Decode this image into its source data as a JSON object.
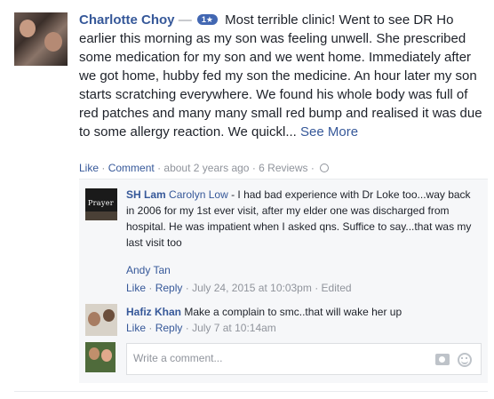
{
  "review": {
    "author": "Charlotte Choy",
    "separator": "—",
    "rating_badge": "1★",
    "text": "Most terrible clinic! Went to see DR Ho earlier this morning as my son was feeling unwell. She prescribed some medication for my son and we went home. Immediately after we got home, hubby fed my son the medicine. An hour later my son starts scratching everywhere. We found his whole body was full of red patches and many many small red bump and realised it was due to some allergy reaction. We quickl...",
    "see_more": "See More",
    "actions": {
      "like": "Like",
      "comment": "Comment",
      "time": "about 2 years ago",
      "reviews": "6 Reviews",
      "sep": "·"
    }
  },
  "comments": [
    {
      "author": "SH Lam",
      "avatar_text": "Prayer",
      "mention": "Carolyn Low",
      "text": "- I had bad experience with Dr Loke too...way back in 2006 for my 1st ever visit, after my elder one was discharged from hospital. He was impatient when I asked qns. Suffice to say...that was my last visit too",
      "trailing_mention": "Andy Tan",
      "like": "Like",
      "reply": "Reply",
      "time": "July 24, 2015 at 10:03pm",
      "edited": "Edited"
    },
    {
      "author": "Hafiz Khan",
      "text": "Make a complain to smc..that will wake her up",
      "like": "Like",
      "reply": "Reply",
      "time": "July 7 at 10:14am"
    }
  ],
  "composer": {
    "placeholder": "Write a comment...",
    "icons": [
      "camera-icon",
      "emoji-icon"
    ]
  },
  "colors": {
    "link": "#365899",
    "meta": "#90949c",
    "badge": "#4267b2",
    "comment_bg": "#f6f7f9"
  }
}
